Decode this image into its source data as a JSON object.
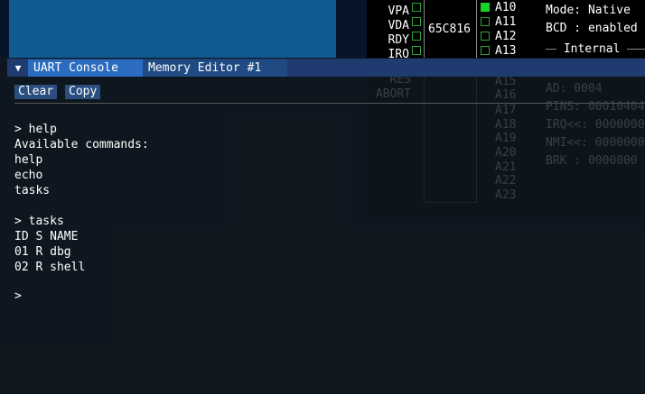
{
  "cpu_pins": {
    "left_pins": [
      {
        "name": "VPA",
        "on": false
      },
      {
        "name": "VDA",
        "on": false
      },
      {
        "name": "RDY",
        "on": false
      },
      {
        "name": "IRQ",
        "on": false
      },
      {
        "name": "RES",
        "on": false
      },
      {
        "name": "ABORT",
        "on": false
      }
    ],
    "chip_name": "65C816",
    "right_pins": [
      {
        "name": "A10",
        "on": true
      },
      {
        "name": "A11",
        "on": false
      },
      {
        "name": "A12",
        "on": false
      },
      {
        "name": "A13",
        "on": false
      },
      {
        "name": "A15",
        "on": false
      },
      {
        "name": "A16",
        "on": false
      },
      {
        "name": "A17",
        "on": false
      },
      {
        "name": "A18",
        "on": false
      },
      {
        "name": "A19",
        "on": false
      },
      {
        "name": "A20",
        "on": false
      },
      {
        "name": "A21",
        "on": false
      },
      {
        "name": "A22",
        "on": false
      },
      {
        "name": "A23",
        "on": false
      }
    ]
  },
  "cpu_status": {
    "mode": "Mode: Native",
    "bcd": "BCD : enabled",
    "internal": "Internal",
    "ad": "AD: 0004",
    "pins": "PINS: 00010404",
    "irq": "IRQ<<: 0000000",
    "nmi": "NMI<<: 0000000",
    "brk": "BRK  : 0000000"
  },
  "window": {
    "tabs": [
      {
        "label": "UART Console",
        "active": true
      },
      {
        "label": "Memory Editor #1",
        "active": false
      }
    ],
    "collapse_glyph": "▼"
  },
  "toolbar": {
    "clear": "Clear",
    "copy": "Copy"
  },
  "console": {
    "lines": [
      "> help",
      "Available commands:",
      "help",
      "echo",
      "tasks",
      "",
      "> tasks",
      "ID S NAME",
      "01 R dbg",
      "02 R shell",
      "",
      ">"
    ]
  },
  "colors": {
    "pin_on": "#19d226",
    "pin_off": "#2fa23a",
    "tab_active": "#2b6cc0",
    "titlebar": "#1f3b70"
  }
}
